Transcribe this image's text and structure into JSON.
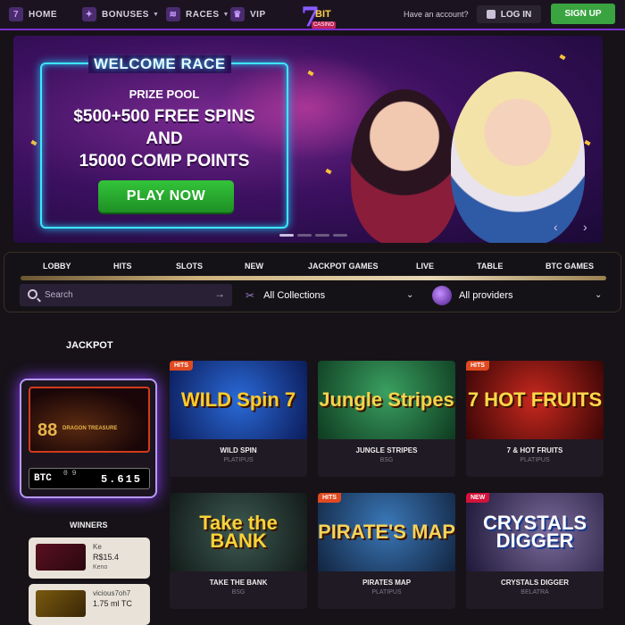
{
  "nav": {
    "home": "HOME",
    "bonuses": "BONUSES",
    "races": "RACES",
    "vip": "VIP",
    "logo_number": "7",
    "logo_bit": "BIT",
    "logo_casino": "CASINO",
    "have_account": "Have an account?",
    "login": "LOG IN",
    "signup": "SIGN UP"
  },
  "hero": {
    "title": "WELCOME RACE",
    "subtitle": "PRIZE POOL",
    "line1": "$500+500 FREE SPINS",
    "line2": "AND",
    "line3": "15000 COMP POINTS",
    "cta": "PLAY NOW",
    "slides": 4,
    "active_slide": 1
  },
  "categories": [
    "LOBBY",
    "HITS",
    "SLOTS",
    "NEW",
    "JACKPOT GAMES",
    "LIVE",
    "TABLE",
    "BTC GAMES"
  ],
  "filters": {
    "search_placeholder": "Search",
    "collections": "All Collections",
    "providers": "All providers"
  },
  "sidebar": {
    "jackpot_title": "JACKPOT",
    "jackpot_game_title": "88",
    "jackpot_game_subtitle": "DRAGON TREASURE",
    "currency": "BTC",
    "roll_digits": "0 9",
    "amount": "5.615",
    "winners_title": "WINNERS",
    "winners": [
      {
        "name": "Ke",
        "amount": "R$15.4",
        "game": "Keno"
      },
      {
        "name": "vicious7oh7",
        "amount": "1.75 ml TC",
        "game": ""
      }
    ]
  },
  "games": [
    {
      "name": "WILD SPIN",
      "provider": "PLATIPUS",
      "badge": "HITS",
      "art": "WILD Spin 7"
    },
    {
      "name": "JUNGLE STRIPES",
      "provider": "BSG",
      "badge": "",
      "art": "Jungle Stripes"
    },
    {
      "name": "7 & HOT FRUITS",
      "provider": "PLATIPUS",
      "badge": "HITS",
      "art": "7 HOT FRUITS"
    },
    {
      "name": "TAKE THE BANK",
      "provider": "BSG",
      "badge": "",
      "art": "Take the BANK"
    },
    {
      "name": "PIRATES MAP",
      "provider": "PLATIPUS",
      "badge": "HITS",
      "art": "PIRATE'S MAP"
    },
    {
      "name": "CRYSTALS DIGGER",
      "provider": "BELATRA",
      "badge": "NEW",
      "art": "CRYSTALS DIGGER"
    }
  ],
  "colors": {
    "accent_purple": "#7b2fd0",
    "signup_green": "#3aa440",
    "neon_cyan": "#3fe6ff",
    "hits_badge": "#e04a20",
    "new_badge": "#d3123b"
  }
}
